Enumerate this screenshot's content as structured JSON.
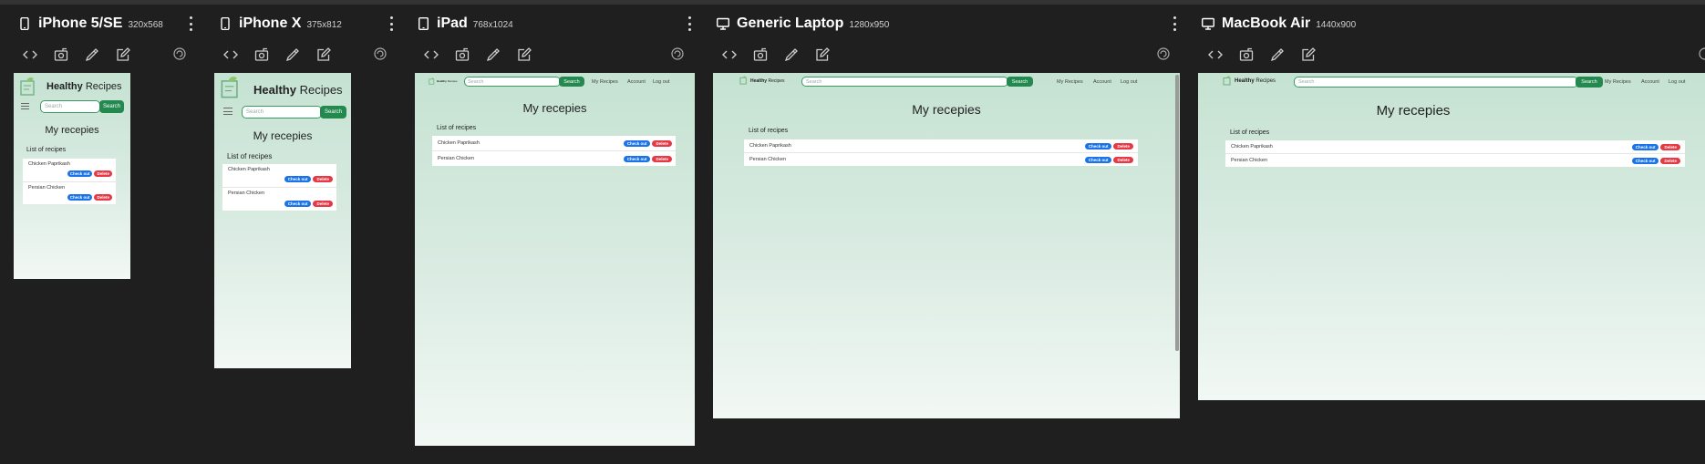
{
  "colors": {
    "page_bg": "#1f1f1f",
    "brand_green": "#23894f",
    "check_out_blue": "#1a73e8",
    "delete_red": "#e53946"
  },
  "icons": {
    "phone": "mobile-phone-icon",
    "tablet": "tablet-icon",
    "laptop": "monitor-icon",
    "menu": "kebab-menu-icon",
    "code": "code-icon",
    "screenshot": "camera-icon",
    "color_picker": "eyedropper-icon",
    "edit": "edit-icon",
    "rotate": "rotate-icon"
  },
  "site": {
    "brand_bold": "Healthy",
    "brand_rest": "Recipes",
    "search_placeholder": "Search",
    "search_button": "Search",
    "nav": [
      "My Recipes",
      "Account",
      "Log out"
    ],
    "page_title": "My recepies",
    "list_title": "List of recipes",
    "recipes": [
      {
        "name": "Chicken Paprikash"
      },
      {
        "name": "Persian Chicken"
      }
    ],
    "check_out_label": "Check out",
    "delete_label": "Delete"
  },
  "devices": [
    {
      "name": "iPhone 5/SE",
      "size": "320x568",
      "type": "phone"
    },
    {
      "name": "iPhone X",
      "size": "375x812",
      "type": "phone"
    },
    {
      "name": "iPad",
      "size": "768x1024",
      "type": "tablet"
    },
    {
      "name": "Generic Laptop",
      "size": "1280x950",
      "type": "laptop"
    },
    {
      "name": "MacBook Air",
      "size": "1440x900",
      "type": "laptop"
    }
  ]
}
